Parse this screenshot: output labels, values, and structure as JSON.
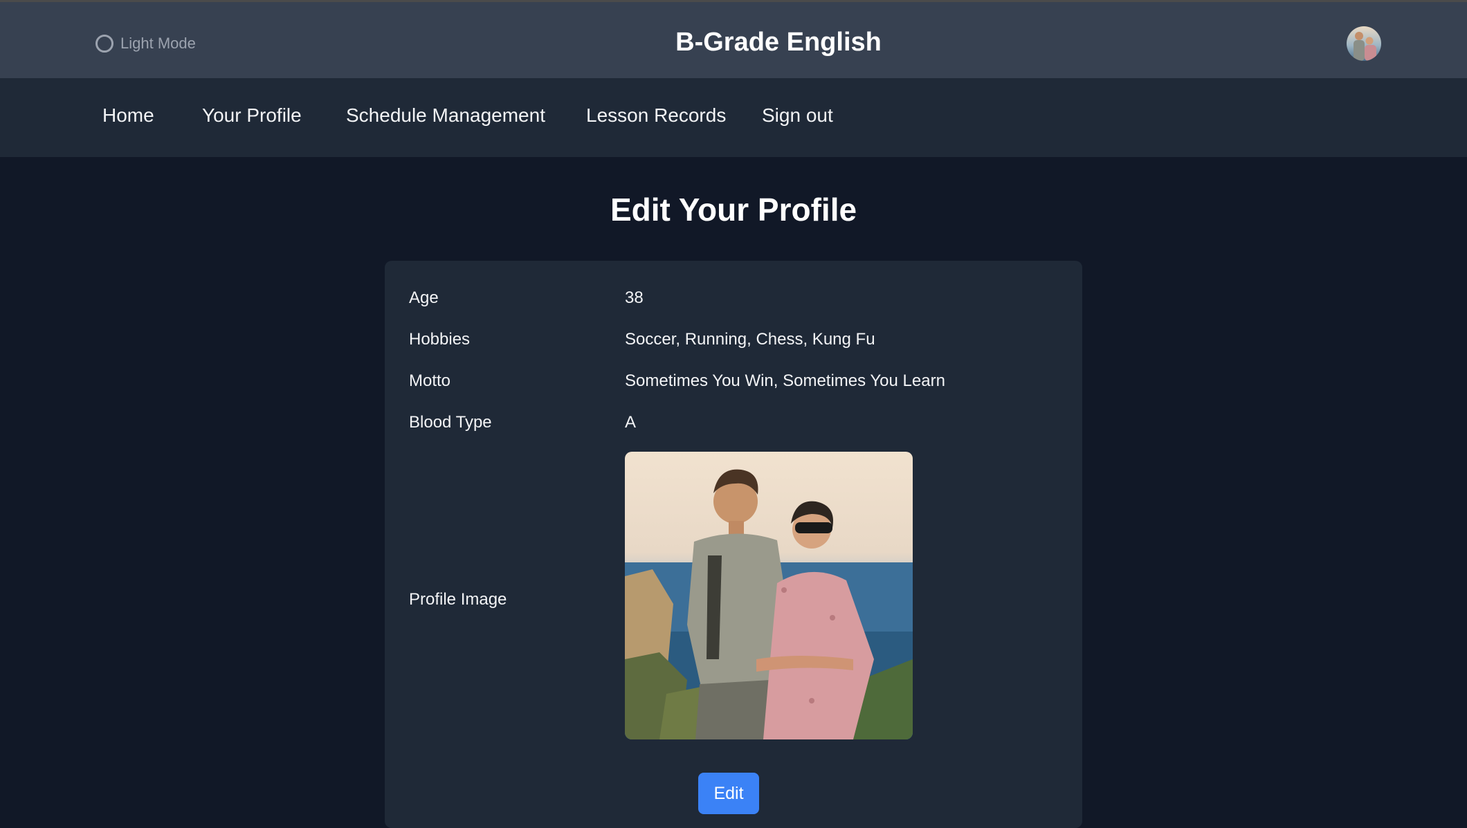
{
  "header": {
    "mode_toggle_label": "Light Mode",
    "brand": "B-Grade English"
  },
  "nav": {
    "items": [
      {
        "label": "Home"
      },
      {
        "label": "Your Profile"
      },
      {
        "label": "Schedule Management"
      },
      {
        "label": "Lesson Records"
      },
      {
        "label": "Sign out"
      }
    ]
  },
  "main": {
    "title": "Edit Your Profile",
    "fields": [
      {
        "label": "Age",
        "value": "38"
      },
      {
        "label": "Hobbies",
        "value": "Soccer, Running, Chess, Kung Fu"
      },
      {
        "label": "Motto",
        "value": "Sometimes You Win, Sometimes You Learn"
      },
      {
        "label": "Blood Type",
        "value": "A"
      }
    ],
    "profile_image_label": "Profile Image",
    "edit_label": "Edit"
  },
  "colors": {
    "header_bg": "#374151",
    "nav_bg": "#1f2937",
    "page_bg": "#111827",
    "card_bg": "#1f2937",
    "accent": "#3b82f6"
  }
}
